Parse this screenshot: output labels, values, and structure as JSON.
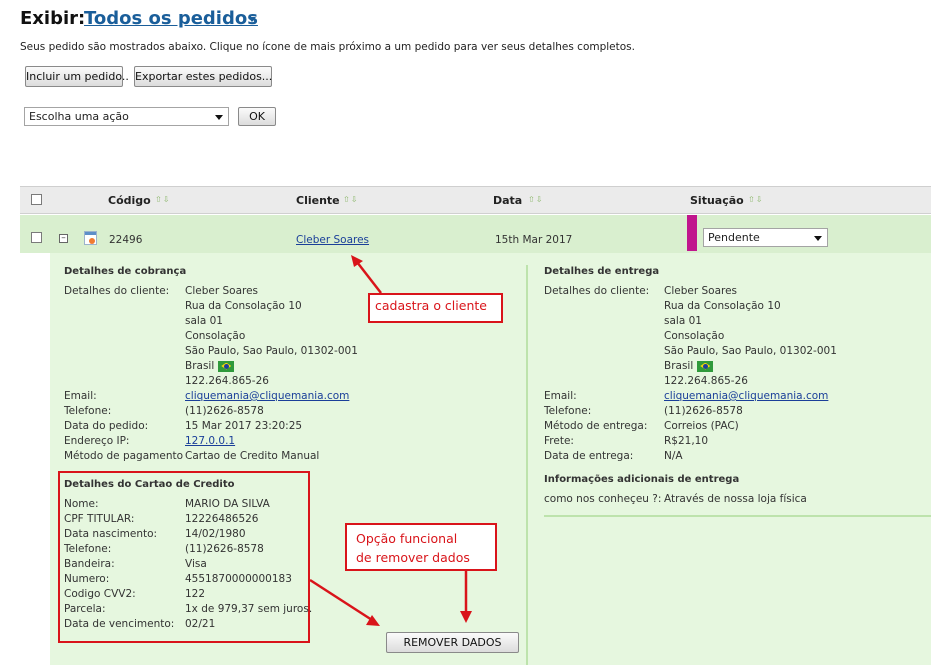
{
  "header": {
    "view_label": "Exibir:",
    "view_selected": "Todos os pedidos",
    "intro_text": "Seus pedido são mostrados abaixo. Clique no ícone de mais próximo a um pedido para ver seus detalhes completos."
  },
  "toolbar": {
    "add_order_label": "Incluir um pedido..",
    "export_label": "Exportar estes pedidos...",
    "action_select": "Escolha uma ação",
    "ok_label": "OK"
  },
  "table": {
    "columns": [
      "Código",
      "Cliente",
      "Data",
      "Situação"
    ],
    "row": {
      "code": "22496",
      "customer": "Cleber Soares",
      "date": "15th Mar 2017",
      "status": "Pendente",
      "status_color": "#c0168d"
    }
  },
  "billing": {
    "title": "Detalhes de cobrança",
    "customer_label": "Detalhes do cliente:",
    "address_lines": [
      "Cleber Soares",
      "Rua da Consolação 10",
      "sala 01",
      "Consolação",
      "São Paulo, Sao Paulo, 01302-001",
      "Brasil",
      "122.264.865-26"
    ],
    "fields": [
      {
        "label": "Email:",
        "value": "cliquemania@cliquemania.com"
      },
      {
        "label": "Telefone:",
        "value": "(11)2626-8578"
      },
      {
        "label": "Data do pedido:",
        "value": "15 Mar 2017 23:20:25"
      },
      {
        "label": "Endereço IP:",
        "value": "127.0.0.1"
      },
      {
        "label": "Método de pagamento",
        "value": "Cartao de Credito Manual"
      }
    ]
  },
  "shipping": {
    "title": "Detalhes de entrega",
    "customer_label": "Detalhes do cliente:",
    "address_lines": [
      "Cleber Soares",
      "Rua da Consolação 10",
      "sala 01",
      "Consolação",
      "São Paulo, Sao Paulo, 01302-001",
      "Brasil",
      "122.264.865-26"
    ],
    "fields": [
      {
        "label": "Email:",
        "value": "cliquemania@cliquemania.com"
      },
      {
        "label": "Telefone:",
        "value": "(11)2626-8578"
      },
      {
        "label": "Método de entrega:",
        "value": "Correios (PAC)"
      },
      {
        "label": "Frete:",
        "value": "R$21,10"
      },
      {
        "label": "Data de entrega:",
        "value": "N/A"
      }
    ],
    "extra_title": "Informações adicionais de entrega",
    "extra_label": "como nos conheçeu ?:",
    "extra_value": "Através de nossa loja física"
  },
  "card": {
    "title": "Detalhes do Cartao de Credito",
    "fields": [
      {
        "label": "Nome:",
        "value": "MARIO DA SILVA"
      },
      {
        "label": "CPF TITULAR:",
        "value": "12226486526"
      },
      {
        "label": "Data nascimento:",
        "value": "14/02/1980"
      },
      {
        "label": "Telefone:",
        "value": "(11)2626-8578"
      },
      {
        "label": "Bandeira:",
        "value": "Visa"
      },
      {
        "label": "Numero:",
        "value": "4551870000000183"
      },
      {
        "label": "Codigo CVV2:",
        "value": "122"
      },
      {
        "label": "Parcela:",
        "value": "1x de 979,37 sem juros."
      },
      {
        "label": "Data de vencimento:",
        "value": "02/21"
      }
    ],
    "remove_label": "REMOVER DADOS"
  },
  "annotations": {
    "customer_note": "cadastra o cliente",
    "remove_note_line1": "Opção funcional",
    "remove_note_line2": "de remover dados",
    "color": "#d9141a"
  }
}
